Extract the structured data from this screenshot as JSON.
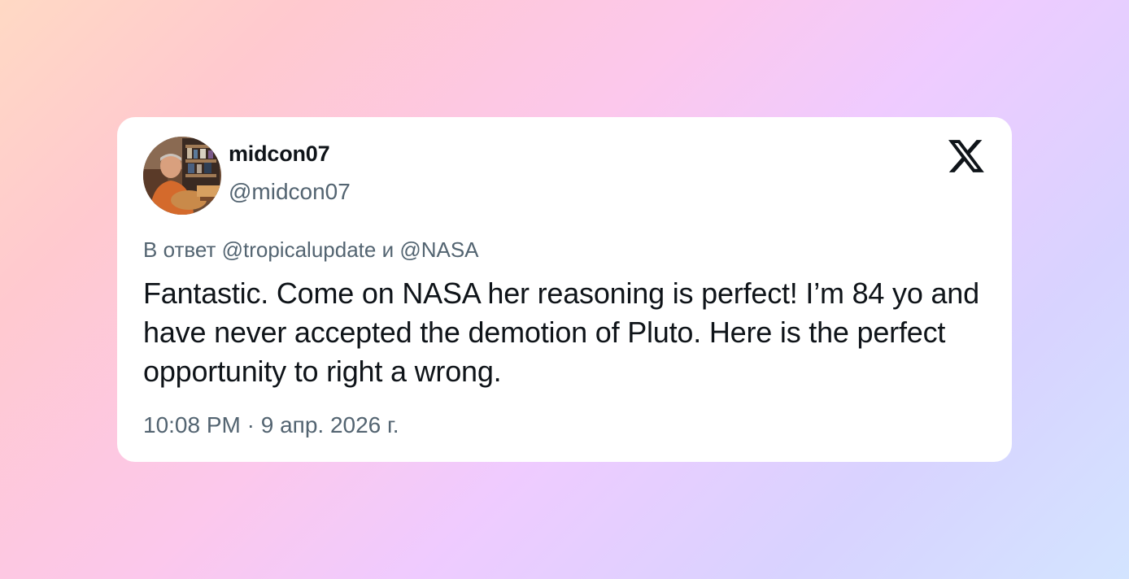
{
  "tweet": {
    "display_name": "midcon07",
    "handle": "@midcon07",
    "reply_context": "В ответ @tropicalupdate и @NASA",
    "text": "Fantastic. Come on NASA her reasoning is perfect! I’m 84 yo and have never accepted the demotion of Pluto. Here is the perfect opportunity to right a wrong.",
    "timestamp": "10:08 PM · 9 апр. 2026 г."
  },
  "icons": {
    "brand": "x-logo-icon",
    "avatar": "profile-photo"
  },
  "colors": {
    "card_background": "#ffffff",
    "primary_text": "#0f1419",
    "secondary_text": "#536471"
  }
}
